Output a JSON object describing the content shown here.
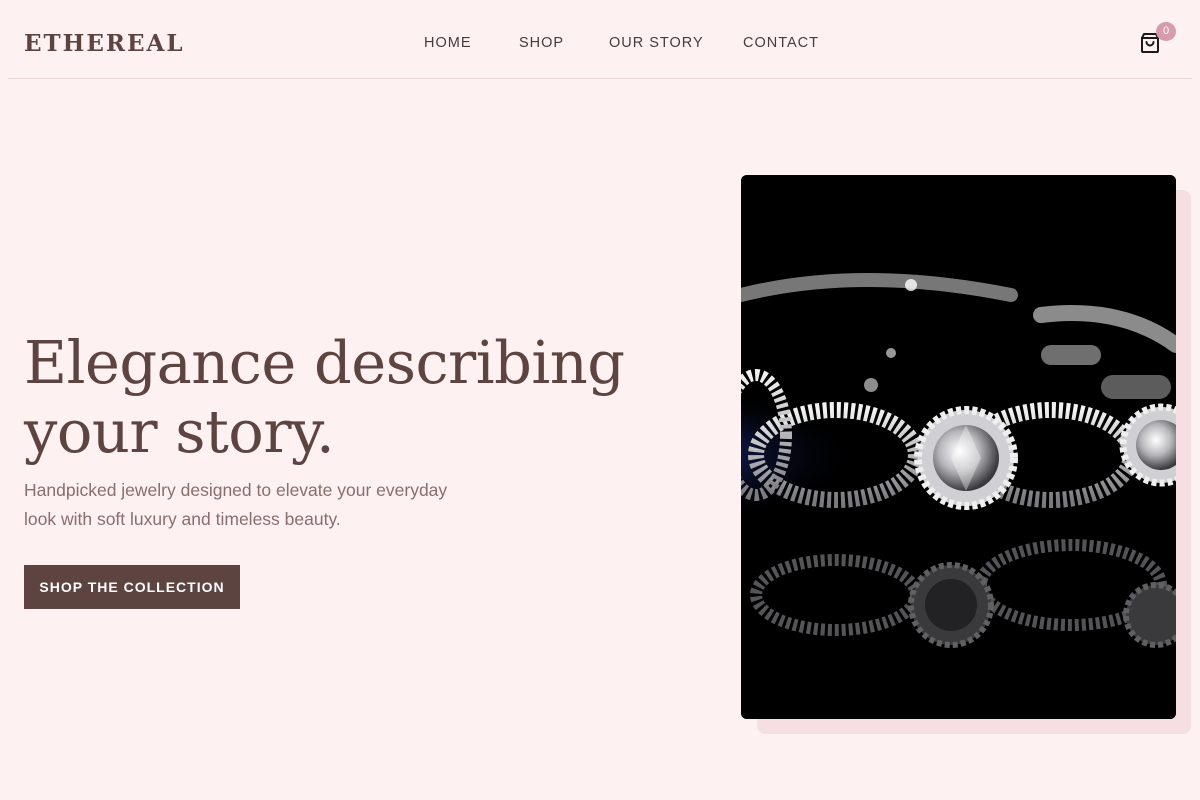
{
  "brand": {
    "name": "ETHEREAL"
  },
  "nav": {
    "items": [
      {
        "label": "HOME"
      },
      {
        "label": "SHOP"
      },
      {
        "label": "OUR STORY"
      },
      {
        "label": "CONTACT"
      }
    ]
  },
  "cart": {
    "icon": "shopping-bag-icon",
    "count": "0"
  },
  "hero": {
    "title": "Elegance describing your story.",
    "subtitle": "Handpicked jewelry designed to elevate your everyday look with soft luxury and timeless beauty.",
    "cta_label": "SHOP THE COLLECTION",
    "image": "diamond-bracelet-photo"
  },
  "colors": {
    "background": "#fdf1f2",
    "primary": "#5e4440",
    "text_muted": "#8a6e6b",
    "accent_pink": "#d69bad",
    "divider": "#ebd6d8"
  }
}
